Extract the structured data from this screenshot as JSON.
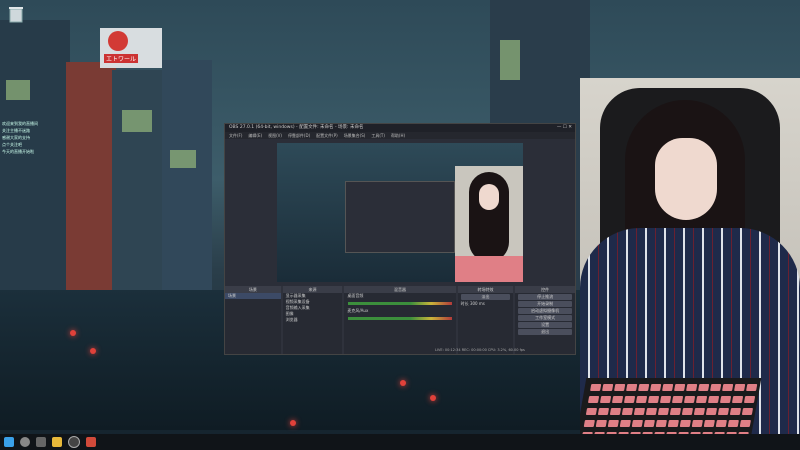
{
  "desktop": {
    "recycle_icon": "recycle-bin-icon",
    "sign_text": "エトワール",
    "chat_lines": [
      "欢迎来到我的直播间",
      "关注主播不迷路",
      "感谢大家的支持",
      "点个关注吧",
      "今天的直播开始啦"
    ]
  },
  "obs": {
    "title": "OBS 27.0.1 (64-bit, windows) - 配置文件: 未命名 - 场景: 未命名",
    "menu": [
      "文件(F)",
      "编辑(E)",
      "视图(V)",
      "停靠部件(D)",
      "配置文件(P)",
      "场景集合(S)",
      "工具(T)",
      "帮助(H)"
    ],
    "docks": {
      "scenes_header": "场景",
      "scenes": [
        "场景"
      ],
      "sources_header": "来源",
      "sources": [
        "显示器采集",
        "视频采集设备",
        "音频输入采集",
        "图像",
        "浏览器"
      ],
      "mixer_header": "混音器",
      "mixer": [
        "桌面音频",
        "麦克风/Aux"
      ],
      "transitions_header": "转场特效",
      "transition_value": "淡出",
      "duration_label": "时长",
      "duration_value": "300 ms",
      "controls_header": "控件",
      "controls": [
        "停止推流",
        "开始录制",
        "启动虚拟摄像机",
        "工作室模式",
        "设置",
        "退出"
      ]
    },
    "status": "LIVE: 00:12:34  REC: 00:00:00  CPU: 3.2%, 60.00 fps"
  },
  "colors": {
    "lamp": "#e0413a",
    "accent": "#3c8f3c"
  },
  "taskbar": {
    "icons": [
      "windows-start-icon",
      "search-icon",
      "taskview-icon",
      "explorer-icon",
      "obs-icon",
      "browser-icon"
    ]
  }
}
